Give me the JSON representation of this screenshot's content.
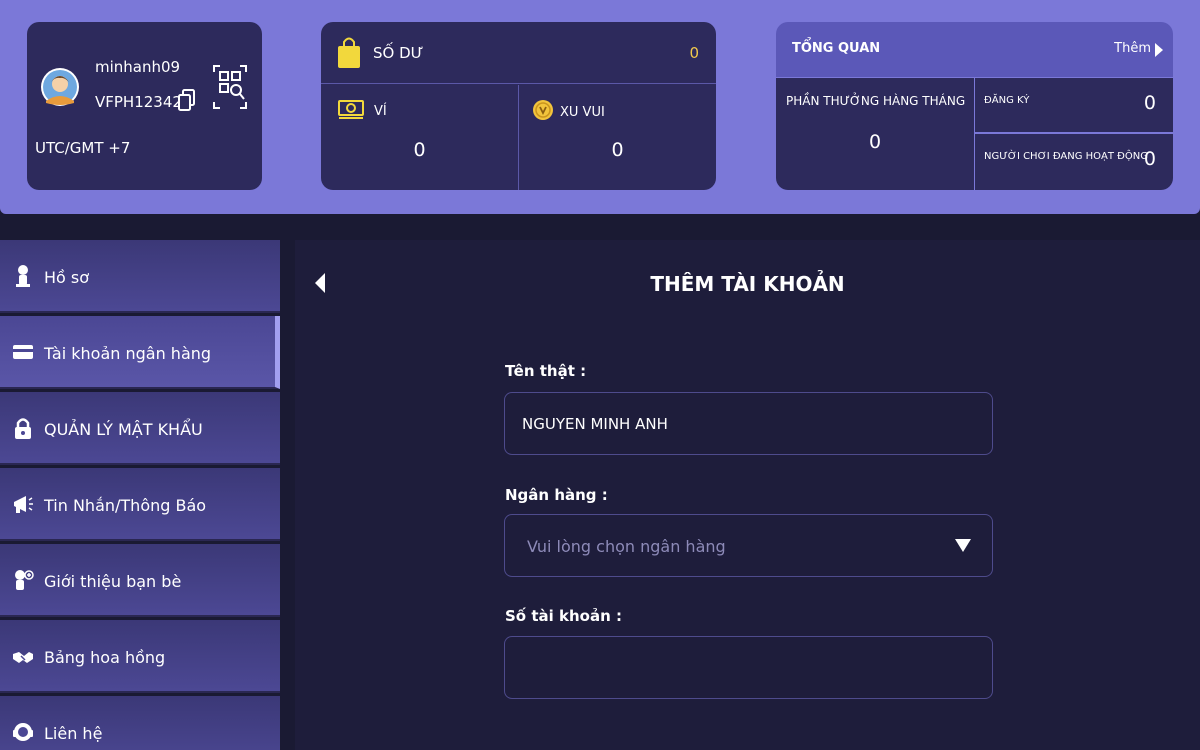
{
  "user": {
    "username": "minhanh09",
    "user_id": "VFPH123429",
    "timezone": "UTC/GMT +7"
  },
  "balance": {
    "title": "SỐ DƯ",
    "value": "0",
    "wallet": {
      "label": "VÍ",
      "value": "0"
    },
    "coins": {
      "label": "XU VUI",
      "value": "0"
    }
  },
  "overview": {
    "title": "TỔNG QUAN",
    "more_label": "Thêm",
    "monthly_reward": {
      "label": "PHẦN THƯỞNG HÀNG THÁNG",
      "value": "0"
    },
    "registered": {
      "label": "ĐĂNG KÝ",
      "value": "0"
    },
    "active_players": {
      "label": "NGƯỜI CHƠI ĐANG HOẠT ĐỘNG",
      "value": "0"
    }
  },
  "sidebar": {
    "items": [
      {
        "label": "Hồ sơ",
        "icon": "person-icon"
      },
      {
        "label": "Tài khoản ngân hàng",
        "icon": "card-icon",
        "active": true
      },
      {
        "label": "QUẢN LÝ MẬT KHẨU",
        "icon": "lock-icon"
      },
      {
        "label": "Tin Nhắn/Thông Báo",
        "icon": "megaphone-icon"
      },
      {
        "label": "Giới thiệu bạn bè",
        "icon": "add-user-icon"
      },
      {
        "label": "Bảng hoa hồng",
        "icon": "handshake-icon"
      },
      {
        "label": "Liên hệ",
        "icon": "support-icon"
      }
    ]
  },
  "form": {
    "title": "THÊM TÀI KHOẢN",
    "real_name": {
      "label": "Tên thật :",
      "value": "NGUYEN MINH ANH"
    },
    "bank": {
      "label": "Ngân hàng :",
      "placeholder": "Vui lòng chọn ngân hàng"
    },
    "account_number": {
      "label": "Số tài khoản :",
      "value": ""
    }
  },
  "colors": {
    "top_bar": "#7b78d8",
    "card": "#2d2a5c",
    "main_bg": "#1e1d3b",
    "balance_value": "#f2c94c"
  }
}
